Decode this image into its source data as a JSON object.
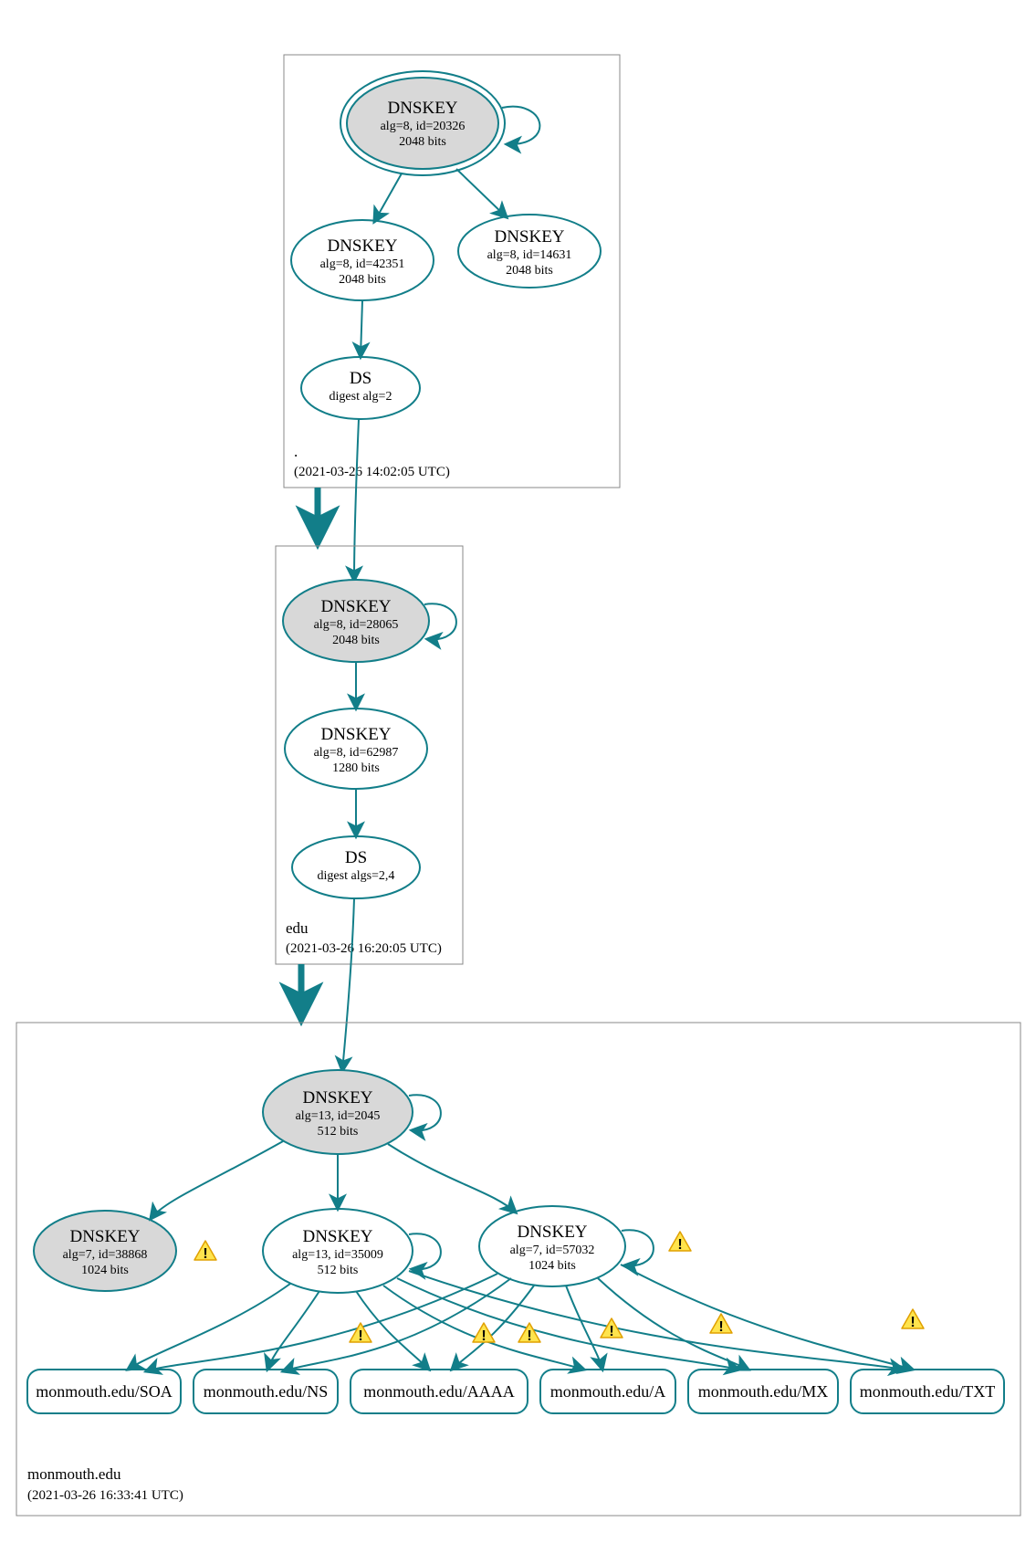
{
  "colors": {
    "accent": "#127e89",
    "node_fill_grey": "#d8d8d8",
    "warning": "#ffe44d"
  },
  "icons": {
    "warning": "warning-triangle-icon"
  },
  "zones": [
    {
      "id": "root",
      "name": ".",
      "time": "(2021-03-26 14:02:05 UTC)"
    },
    {
      "id": "edu",
      "name": "edu",
      "time": "(2021-03-26 16:20:05 UTC)"
    },
    {
      "id": "mon",
      "name": "monmouth.edu",
      "time": "(2021-03-26 16:33:41 UTC)"
    }
  ],
  "nodes": {
    "root_ksk": {
      "title": "DNSKEY",
      "line1": "alg=8, id=20326",
      "line2": "2048 bits"
    },
    "root_zsk": {
      "title": "DNSKEY",
      "line1": "alg=8, id=42351",
      "line2": "2048 bits"
    },
    "root_k2": {
      "title": "DNSKEY",
      "line1": "alg=8, id=14631",
      "line2": "2048 bits"
    },
    "root_ds": {
      "title": "DS",
      "line1": "digest alg=2",
      "line2": ""
    },
    "edu_ksk": {
      "title": "DNSKEY",
      "line1": "alg=8, id=28065",
      "line2": "2048 bits"
    },
    "edu_zsk": {
      "title": "DNSKEY",
      "line1": "alg=8, id=62987",
      "line2": "1280 bits"
    },
    "edu_ds": {
      "title": "DS",
      "line1": "digest algs=2,4",
      "line2": ""
    },
    "mon_ksk": {
      "title": "DNSKEY",
      "line1": "alg=13, id=2045",
      "line2": "512 bits"
    },
    "mon_k_grey": {
      "title": "DNSKEY",
      "line1": "alg=7, id=38868",
      "line2": "1024 bits"
    },
    "mon_k_mid": {
      "title": "DNSKEY",
      "line1": "alg=13, id=35009",
      "line2": "512 bits"
    },
    "mon_k_right": {
      "title": "DNSKEY",
      "line1": "alg=7, id=57032",
      "line2": "1024 bits"
    }
  },
  "records": [
    {
      "label": "monmouth.edu/SOA"
    },
    {
      "label": "monmouth.edu/NS"
    },
    {
      "label": "monmouth.edu/AAAA"
    },
    {
      "label": "monmouth.edu/A"
    },
    {
      "label": "monmouth.edu/MX"
    },
    {
      "label": "monmouth.edu/TXT"
    }
  ]
}
